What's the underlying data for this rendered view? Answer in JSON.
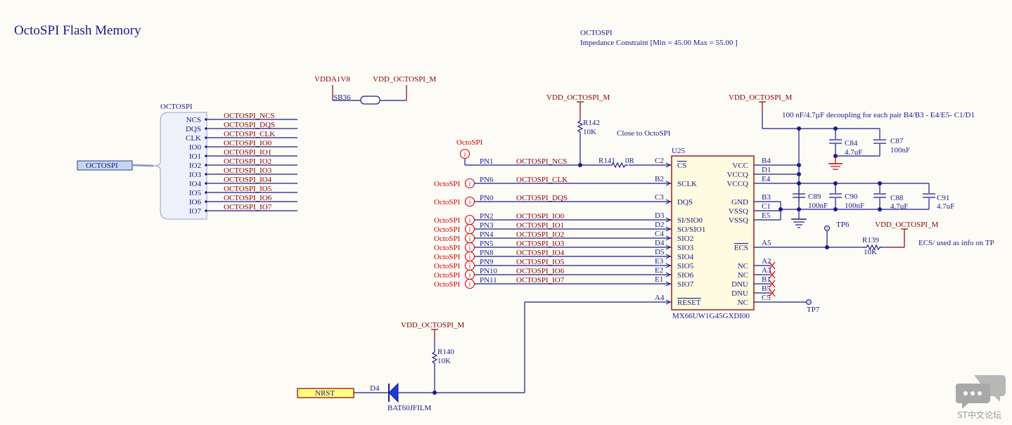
{
  "title": "OctoSPI Flash Memory",
  "constraint": {
    "line1": "OCTOSPI",
    "line2": "Impedance Constraint [Min = 45.00   Max = 55.00   ]"
  },
  "bus": {
    "label": "OCTOSPI",
    "port_label": "OCTOSPI",
    "pins": [
      "NCS",
      "DQS",
      "CLK",
      "IO0",
      "IO1",
      "IO2",
      "IO3",
      "IO4",
      "IO5",
      "IO6",
      "IO7"
    ],
    "nets": [
      "OCTOSPI_NCS",
      "OCTOSPI_DQS",
      "OCTOSPI_CLK",
      "OCTOSPI_IO0",
      "OCTOSPI_IO1",
      "OCTOSPI_IO2",
      "OCTOSPI_IO3",
      "OCTOSPI_IO4",
      "OCTOSPI_IO5",
      "OCTOSPI_IO6",
      "OCTOSPI_IO7"
    ]
  },
  "solder_bridge": {
    "ref": "SB36",
    "left_net": "VDDA1V8",
    "right_net": "VDD_OCTOSPI_M"
  },
  "power": {
    "vdd": "VDD_OCTOSPI_M"
  },
  "ic": {
    "ref": "U25",
    "part": "MX66UW1G45GXDI00",
    "left_pins": [
      {
        "num": "C2",
        "name": "CS",
        "bar": true
      },
      {
        "num": "B2",
        "name": "SCLK"
      },
      {
        "num": "C3",
        "name": "DQS"
      },
      {
        "num": "D3",
        "name": "SI/SIO0"
      },
      {
        "num": "D2",
        "name": "SO/SIO1"
      },
      {
        "num": "C4",
        "name": "SIO2"
      },
      {
        "num": "D4",
        "name": "SIO3"
      },
      {
        "num": "D5",
        "name": "SIO4"
      },
      {
        "num": "E3",
        "name": "SIO5"
      },
      {
        "num": "E2",
        "name": "SIO6"
      },
      {
        "num": "E1",
        "name": "SIO7"
      },
      {
        "num": "A4",
        "name": "RESET",
        "bar": true
      }
    ],
    "right_pins": [
      {
        "num": "B4",
        "name": "VCC"
      },
      {
        "num": "D1",
        "name": "VCCQ"
      },
      {
        "num": "E4",
        "name": "VCCQ"
      },
      {
        "num": "B3",
        "name": "GND"
      },
      {
        "num": "C1",
        "name": "VSSQ"
      },
      {
        "num": "E5",
        "name": "VSSQ"
      },
      {
        "num": "A5",
        "name": "ECS",
        "bar": true
      },
      {
        "num": "A2",
        "name": "NC"
      },
      {
        "num": "A3",
        "name": "NC"
      },
      {
        "num": "B1",
        "name": "DNU"
      },
      {
        "num": "B5",
        "name": "DNU"
      },
      {
        "num": "C5",
        "name": "NC"
      }
    ]
  },
  "mcu_ports": {
    "connector": "OctoSPI",
    "rows": [
      {
        "pin": "PN1",
        "net": "OCTOSPI_NCS"
      },
      {
        "pin": "PN6",
        "net": "OCTOSPI_CLK"
      },
      {
        "pin": "PN0",
        "net": "OCTOSPI_DQS"
      },
      {
        "pin": "PN2",
        "net": "OCTOSPI_IO0"
      },
      {
        "pin": "PN3",
        "net": "OCTOSPI_IO1"
      },
      {
        "pin": "PN4",
        "net": "OCTOSPI_IO2"
      },
      {
        "pin": "PN5",
        "net": "OCTOSPI_IO3"
      },
      {
        "pin": "PN8",
        "net": "OCTOSPI_IO4"
      },
      {
        "pin": "PN9",
        "net": "OCTOSPI_IO5"
      },
      {
        "pin": "PN10",
        "net": "OCTOSPI_IO6"
      },
      {
        "pin": "PN11",
        "net": "OCTOSPI_IO7"
      }
    ]
  },
  "components": {
    "r141": {
      "ref": "R141",
      "value": "0R"
    },
    "r142": {
      "ref": "R142",
      "value": "10K"
    },
    "r139": {
      "ref": "R139",
      "value": "10K"
    },
    "r140": {
      "ref": "R140",
      "value": "10K"
    },
    "c84": {
      "ref": "C84",
      "value": "4.7uF"
    },
    "c87": {
      "ref": "C87",
      "value": "100nF"
    },
    "c89": {
      "ref": "C89",
      "value": "100nF"
    },
    "c90": {
      "ref": "C90",
      "value": "100nF"
    },
    "c88": {
      "ref": "C88",
      "value": "4.7uF"
    },
    "c91": {
      "ref": "C91",
      "value": "4.7uF"
    },
    "d4": {
      "ref": "D4",
      "value": "BAT60JFILM"
    },
    "tp6": "TP6",
    "tp7": "TP7"
  },
  "notes": {
    "close_to": "Close to OctoSPI",
    "decoupling": "100 nF/4.7µF decoupling  for each pair B4/B3 - E4/E5- C1/D1",
    "ecs_note": "ECS/ used as info on TP"
  },
  "nrst": "NRST",
  "watermark": "ST中文论坛"
}
